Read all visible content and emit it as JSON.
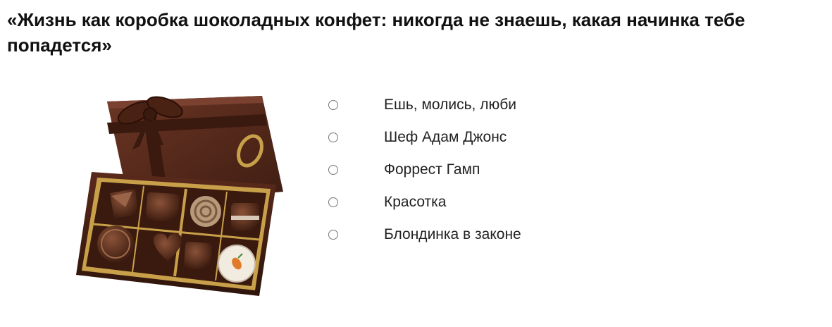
{
  "question": {
    "text": "«Жизнь как коробка шоколадных конфет: никогда не знаешь, какая начинка тебе попадется»"
  },
  "image": {
    "subject": "box-of-chocolates",
    "colors": {
      "box": "#4a2418",
      "lid": "#5a2a1c",
      "ribbon": "#3a1a0e",
      "gold": "#c9a04a"
    }
  },
  "options": [
    {
      "label": "Ешь, молись, люби",
      "selected": false
    },
    {
      "label": "Шеф Адам Джонс",
      "selected": false
    },
    {
      "label": "Форрест Гамп",
      "selected": false
    },
    {
      "label": "Красотка",
      "selected": false
    },
    {
      "label": "Блондинка в законе",
      "selected": false
    }
  ]
}
